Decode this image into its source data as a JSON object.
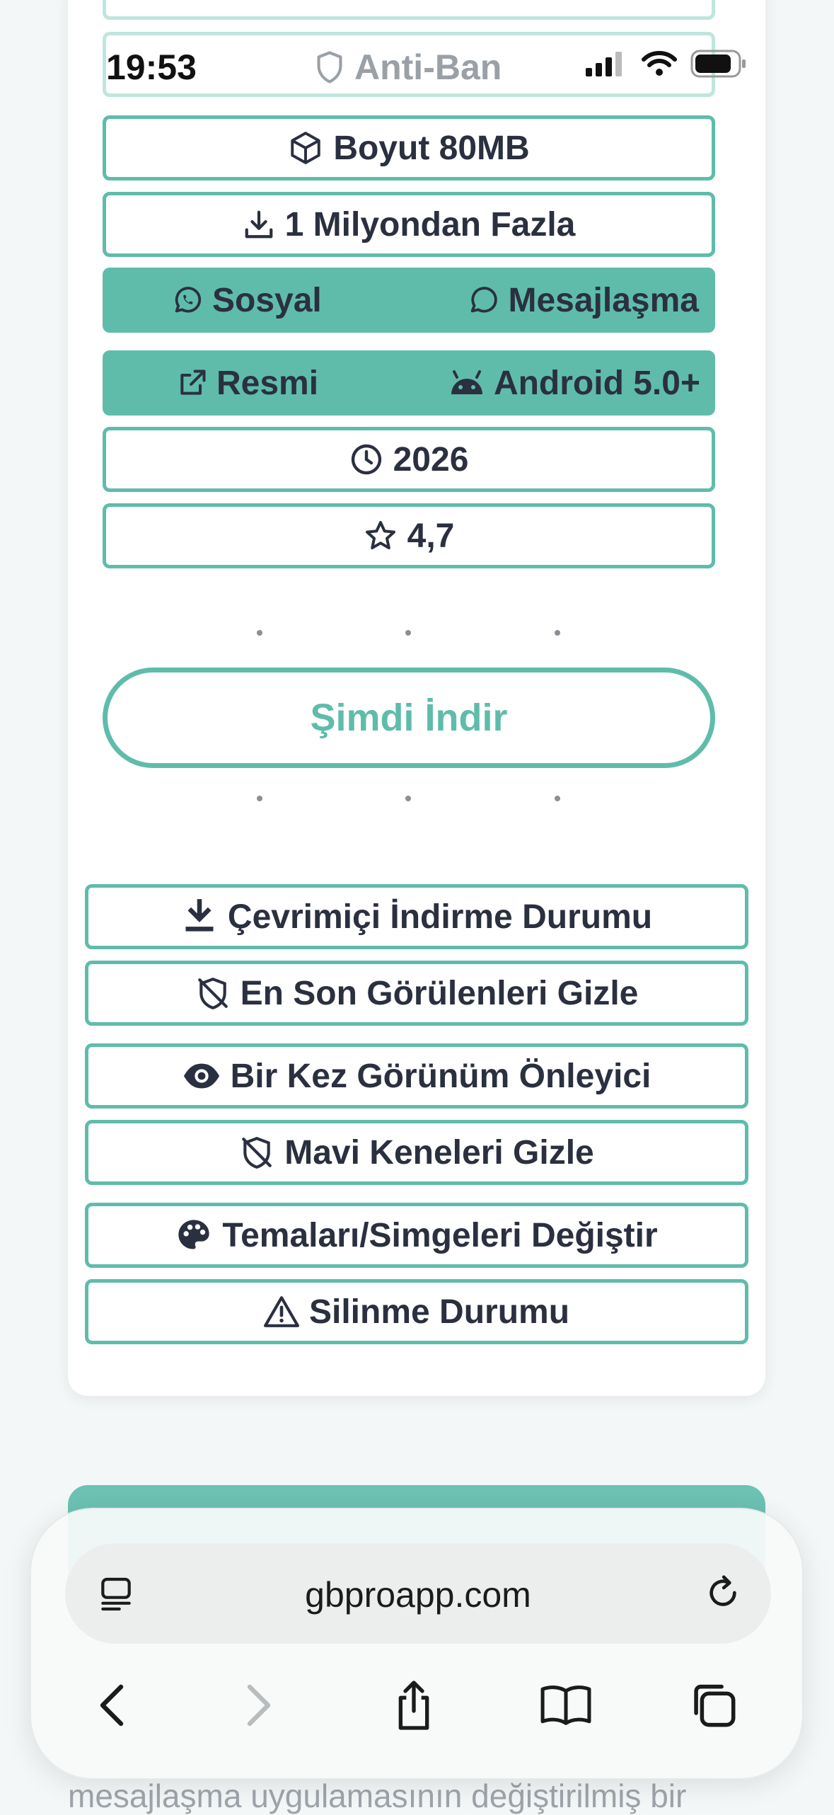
{
  "status_bar": {
    "time": "19:53",
    "center_label": "Anti-Ban"
  },
  "specs": {
    "size": "Boyut 80MB",
    "downloads": "1 Milyondan Fazla",
    "category_left": "Sosyal",
    "category_right": "Mesajlaşma",
    "source": "Resmi",
    "platform": "Android 5.0+",
    "year": "2026",
    "rating": "4,7"
  },
  "download_button": "Şimdi İndir",
  "features": [
    {
      "label": "Çevrimiçi İndirme Durumu",
      "icon": "download-icon"
    },
    {
      "label": "En Son Görülenleri Gizle",
      "icon": "shield-slash-icon"
    },
    {
      "label": "Bir Kez Görünüm Önleyici",
      "icon": "eye-icon"
    },
    {
      "label": "Mavi Keneleri Gizle",
      "icon": "shield-slash-icon"
    },
    {
      "label": "Temaları/Simgeleri Değiştir",
      "icon": "palette-icon"
    },
    {
      "label": "Silinme Durumu",
      "icon": "warning-icon"
    }
  ],
  "browser": {
    "url": "gbproapp.com",
    "partial_text_below": "mesajlaşma uygulamasının değiştirilmiş bir"
  },
  "colors": {
    "accent": "#5fbcab",
    "text": "#2b3040"
  }
}
